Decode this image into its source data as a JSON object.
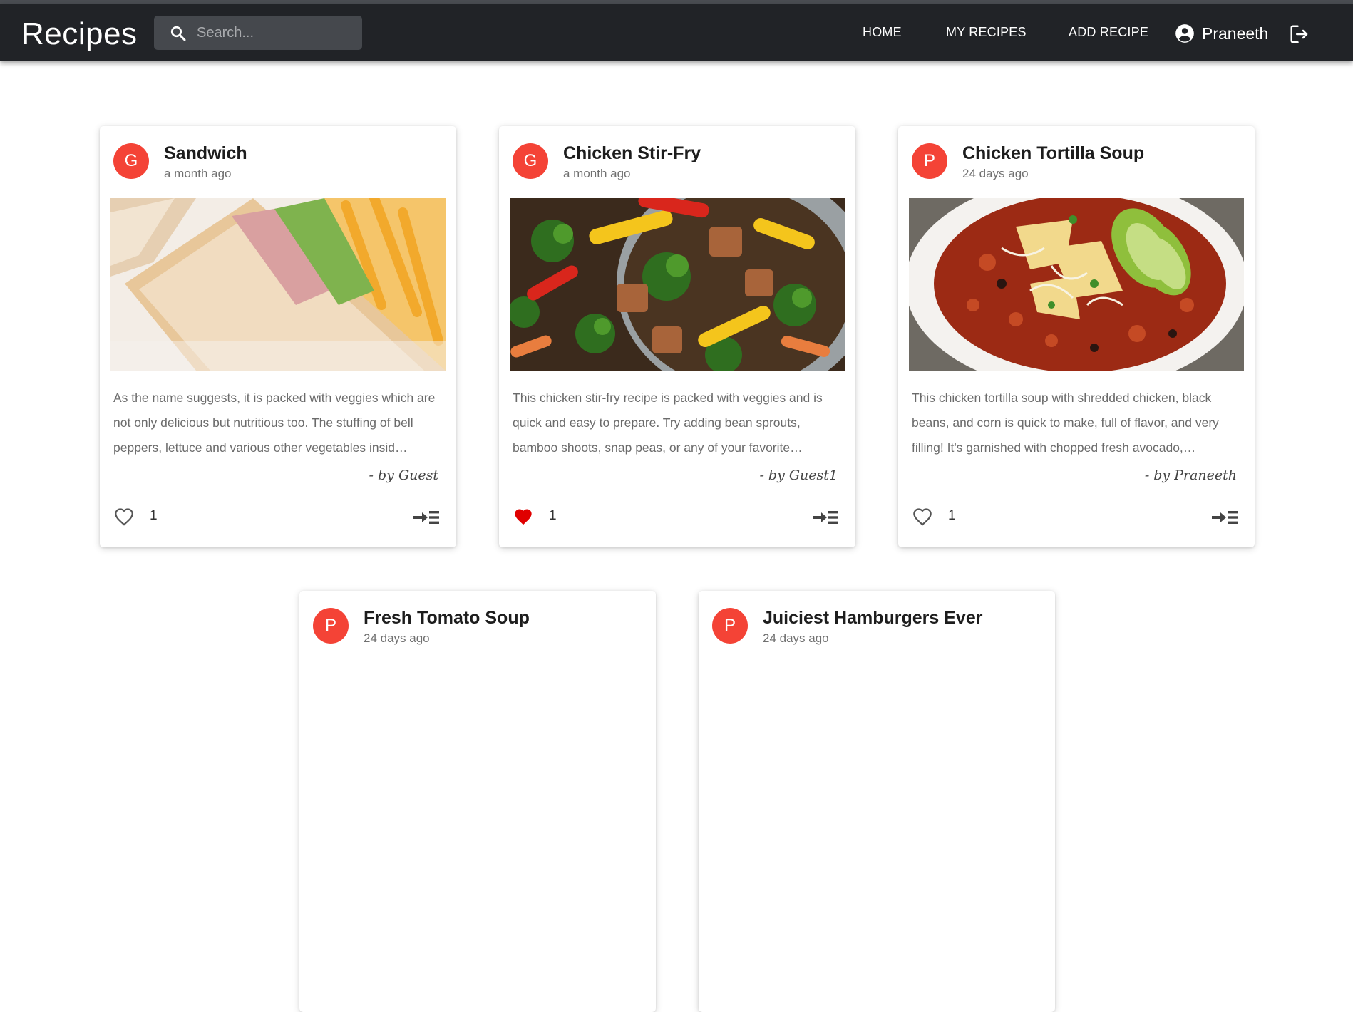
{
  "navbar": {
    "brand": "Recipes",
    "search_placeholder": "Search...",
    "links": [
      "HOME",
      "MY RECIPES",
      "ADD RECIPE"
    ],
    "user_name": "Praneeth"
  },
  "recipes": [
    {
      "initial": "G",
      "title": "Sandwich",
      "date": "a month ago",
      "description": "As the name suggests, it is packed with veggies which are not only delicious but nutritious too. The stuffing of bell peppers, lettuce and various other vegetables insid…",
      "author": "- by Guest",
      "likes": "1",
      "liked": false
    },
    {
      "initial": "G",
      "title": "Chicken Stir-Fry",
      "date": "a month ago",
      "description": "This chicken stir-fry recipe is packed with veggies and is quick and easy to prepare. Try adding bean sprouts, bamboo shoots, snap peas, or any of your favorite…",
      "author": "- by Guest1",
      "likes": "1",
      "liked": true
    },
    {
      "initial": "P",
      "title": "Chicken Tortilla Soup",
      "date": "24 days ago",
      "description": "This chicken tortilla soup with shredded chicken, black beans, and corn is quick to make, full of flavor, and very filling! It's garnished with chopped fresh avocado,…",
      "author": "- by Praneeth",
      "likes": "1",
      "liked": false
    },
    {
      "initial": "P",
      "title": "Fresh Tomato Soup",
      "date": "24 days ago"
    },
    {
      "initial": "P",
      "title": "Juiciest Hamburgers Ever",
      "date": "24 days ago"
    }
  ],
  "colors": {
    "navbar": "#212327",
    "avatar": "#f44336",
    "liked_heart": "#e00000"
  }
}
